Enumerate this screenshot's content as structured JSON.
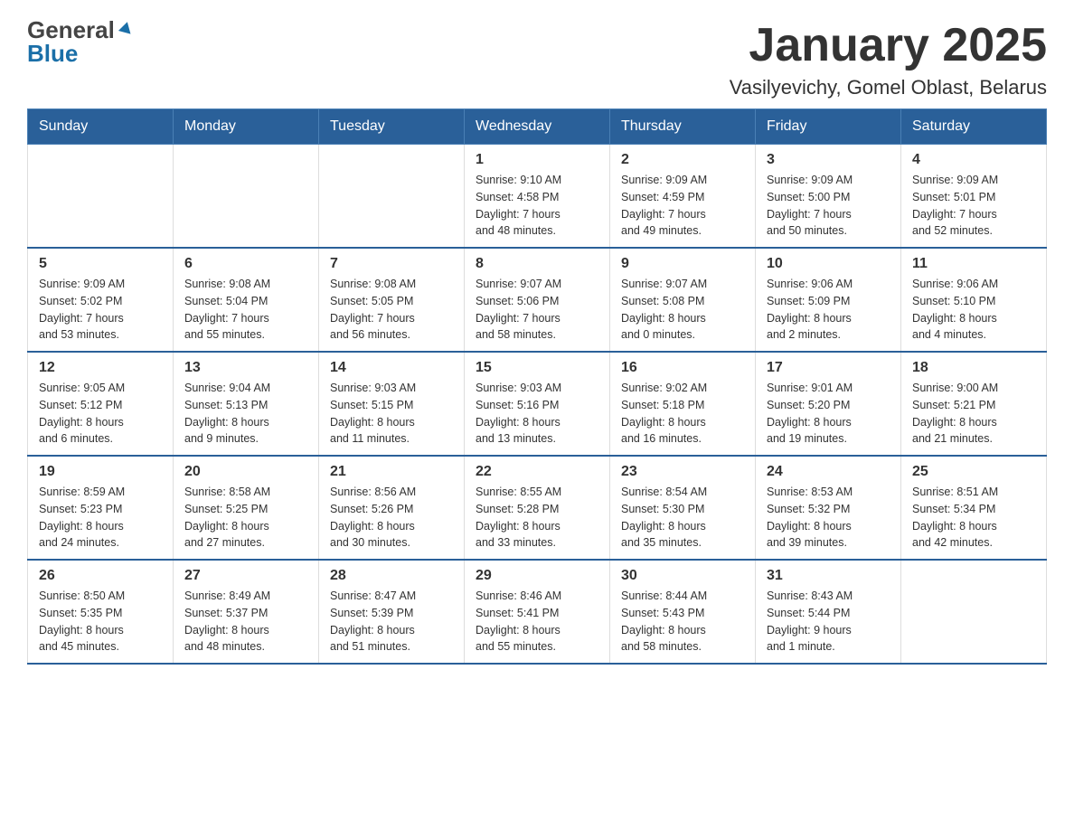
{
  "header": {
    "logo_general": "General",
    "logo_blue": "Blue",
    "title": "January 2025",
    "subtitle": "Vasilyevichy, Gomel Oblast, Belarus"
  },
  "calendar": {
    "days_of_week": [
      "Sunday",
      "Monday",
      "Tuesday",
      "Wednesday",
      "Thursday",
      "Friday",
      "Saturday"
    ],
    "weeks": [
      [
        {
          "day": "",
          "info": ""
        },
        {
          "day": "",
          "info": ""
        },
        {
          "day": "",
          "info": ""
        },
        {
          "day": "1",
          "info": "Sunrise: 9:10 AM\nSunset: 4:58 PM\nDaylight: 7 hours\nand 48 minutes."
        },
        {
          "day": "2",
          "info": "Sunrise: 9:09 AM\nSunset: 4:59 PM\nDaylight: 7 hours\nand 49 minutes."
        },
        {
          "day": "3",
          "info": "Sunrise: 9:09 AM\nSunset: 5:00 PM\nDaylight: 7 hours\nand 50 minutes."
        },
        {
          "day": "4",
          "info": "Sunrise: 9:09 AM\nSunset: 5:01 PM\nDaylight: 7 hours\nand 52 minutes."
        }
      ],
      [
        {
          "day": "5",
          "info": "Sunrise: 9:09 AM\nSunset: 5:02 PM\nDaylight: 7 hours\nand 53 minutes."
        },
        {
          "day": "6",
          "info": "Sunrise: 9:08 AM\nSunset: 5:04 PM\nDaylight: 7 hours\nand 55 minutes."
        },
        {
          "day": "7",
          "info": "Sunrise: 9:08 AM\nSunset: 5:05 PM\nDaylight: 7 hours\nand 56 minutes."
        },
        {
          "day": "8",
          "info": "Sunrise: 9:07 AM\nSunset: 5:06 PM\nDaylight: 7 hours\nand 58 minutes."
        },
        {
          "day": "9",
          "info": "Sunrise: 9:07 AM\nSunset: 5:08 PM\nDaylight: 8 hours\nand 0 minutes."
        },
        {
          "day": "10",
          "info": "Sunrise: 9:06 AM\nSunset: 5:09 PM\nDaylight: 8 hours\nand 2 minutes."
        },
        {
          "day": "11",
          "info": "Sunrise: 9:06 AM\nSunset: 5:10 PM\nDaylight: 8 hours\nand 4 minutes."
        }
      ],
      [
        {
          "day": "12",
          "info": "Sunrise: 9:05 AM\nSunset: 5:12 PM\nDaylight: 8 hours\nand 6 minutes."
        },
        {
          "day": "13",
          "info": "Sunrise: 9:04 AM\nSunset: 5:13 PM\nDaylight: 8 hours\nand 9 minutes."
        },
        {
          "day": "14",
          "info": "Sunrise: 9:03 AM\nSunset: 5:15 PM\nDaylight: 8 hours\nand 11 minutes."
        },
        {
          "day": "15",
          "info": "Sunrise: 9:03 AM\nSunset: 5:16 PM\nDaylight: 8 hours\nand 13 minutes."
        },
        {
          "day": "16",
          "info": "Sunrise: 9:02 AM\nSunset: 5:18 PM\nDaylight: 8 hours\nand 16 minutes."
        },
        {
          "day": "17",
          "info": "Sunrise: 9:01 AM\nSunset: 5:20 PM\nDaylight: 8 hours\nand 19 minutes."
        },
        {
          "day": "18",
          "info": "Sunrise: 9:00 AM\nSunset: 5:21 PM\nDaylight: 8 hours\nand 21 minutes."
        }
      ],
      [
        {
          "day": "19",
          "info": "Sunrise: 8:59 AM\nSunset: 5:23 PM\nDaylight: 8 hours\nand 24 minutes."
        },
        {
          "day": "20",
          "info": "Sunrise: 8:58 AM\nSunset: 5:25 PM\nDaylight: 8 hours\nand 27 minutes."
        },
        {
          "day": "21",
          "info": "Sunrise: 8:56 AM\nSunset: 5:26 PM\nDaylight: 8 hours\nand 30 minutes."
        },
        {
          "day": "22",
          "info": "Sunrise: 8:55 AM\nSunset: 5:28 PM\nDaylight: 8 hours\nand 33 minutes."
        },
        {
          "day": "23",
          "info": "Sunrise: 8:54 AM\nSunset: 5:30 PM\nDaylight: 8 hours\nand 35 minutes."
        },
        {
          "day": "24",
          "info": "Sunrise: 8:53 AM\nSunset: 5:32 PM\nDaylight: 8 hours\nand 39 minutes."
        },
        {
          "day": "25",
          "info": "Sunrise: 8:51 AM\nSunset: 5:34 PM\nDaylight: 8 hours\nand 42 minutes."
        }
      ],
      [
        {
          "day": "26",
          "info": "Sunrise: 8:50 AM\nSunset: 5:35 PM\nDaylight: 8 hours\nand 45 minutes."
        },
        {
          "day": "27",
          "info": "Sunrise: 8:49 AM\nSunset: 5:37 PM\nDaylight: 8 hours\nand 48 minutes."
        },
        {
          "day": "28",
          "info": "Sunrise: 8:47 AM\nSunset: 5:39 PM\nDaylight: 8 hours\nand 51 minutes."
        },
        {
          "day": "29",
          "info": "Sunrise: 8:46 AM\nSunset: 5:41 PM\nDaylight: 8 hours\nand 55 minutes."
        },
        {
          "day": "30",
          "info": "Sunrise: 8:44 AM\nSunset: 5:43 PM\nDaylight: 8 hours\nand 58 minutes."
        },
        {
          "day": "31",
          "info": "Sunrise: 8:43 AM\nSunset: 5:44 PM\nDaylight: 9 hours\nand 1 minute."
        },
        {
          "day": "",
          "info": ""
        }
      ]
    ]
  }
}
